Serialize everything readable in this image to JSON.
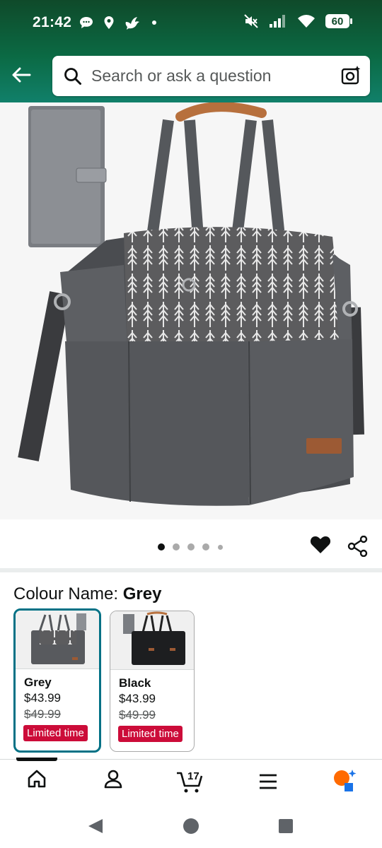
{
  "status_bar": {
    "time": "21:42",
    "battery": "60",
    "left_icons": [
      "chat-bubble-icon",
      "location-pin-icon",
      "bird-icon",
      "dot-icon"
    ],
    "right_icons": [
      "mute-icon",
      "signal-icon",
      "wifi-icon",
      "battery-icon"
    ]
  },
  "header": {
    "back_icon": "back-arrow-icon",
    "search_placeholder": "Search or ask a question",
    "search_icon": "search-icon",
    "camera_icon": "camera-lens-icon",
    "bg_color": "#0b6a44"
  },
  "gallery": {
    "image_count": 5,
    "active_index": 0,
    "favorite_icon": "heart-icon",
    "share_icon": "share-icon"
  },
  "colour": {
    "label": "Colour Name:",
    "selected": "Grey",
    "options": [
      {
        "name": "Grey",
        "price": "$43.99",
        "old_price": "$49.99",
        "badge": "Limited time",
        "selected": true
      },
      {
        "name": "Black",
        "price": "$43.99",
        "old_price": "$49.99",
        "badge": "Limited time",
        "selected": false
      }
    ],
    "accent_color": "#007185",
    "badge_color": "#cc0c39"
  },
  "bottom_nav": {
    "items": [
      "home-icon",
      "account-icon",
      "cart-icon",
      "menu-icon",
      "rufus-ai-icon"
    ],
    "cart_count": "17"
  },
  "system_nav": [
    "back-triangle-icon",
    "home-circle-icon",
    "recents-square-icon"
  ]
}
